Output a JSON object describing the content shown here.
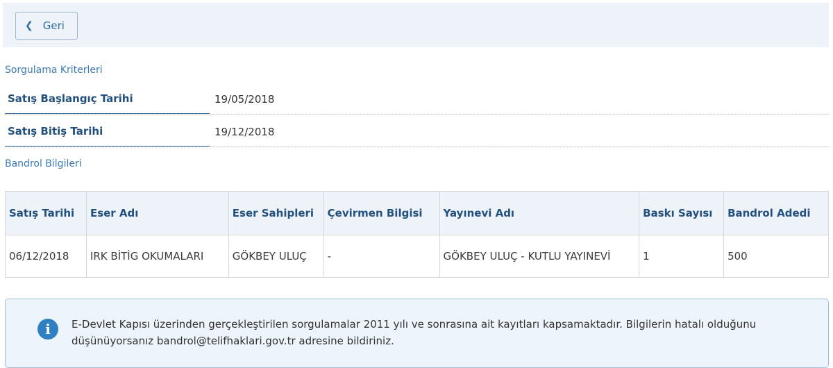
{
  "toolbar": {
    "back_label": "Geri"
  },
  "criteria": {
    "title": "Sorgulama Kriterleri",
    "rows": [
      {
        "label": "Satış Başlangıç Tarihi",
        "value": "19/05/2018"
      },
      {
        "label": "Satış Bitiş Tarihi",
        "value": "19/12/2018"
      }
    ]
  },
  "bandrol": {
    "title": "Bandrol Bilgileri",
    "columns": [
      "Satış Tarihi",
      "Eser Adı",
      "Eser Sahipleri",
      "Çevirmen Bilgisi",
      "Yayınevi Adı",
      "Baskı Sayısı",
      "Bandrol Adedi"
    ],
    "rows": [
      [
        "06/12/2018",
        "IRK BİTİG OKUMALARI",
        "GÖKBEY ULUÇ",
        "-",
        "GÖKBEY ULUÇ - KUTLU YAYINEVİ",
        "1",
        "500"
      ]
    ]
  },
  "info": {
    "icon": "info-icon",
    "text": "E-Devlet Kapısı üzerinden gerçekleştirilen sorgulamalar 2011 yılı ve sonrasına ait kayıtları kapsamaktadır. Bilgilerin hatalı olduğunu düşünüyorsanız bandrol@telifhaklari.gov.tr adresine bildiriniz."
  }
}
